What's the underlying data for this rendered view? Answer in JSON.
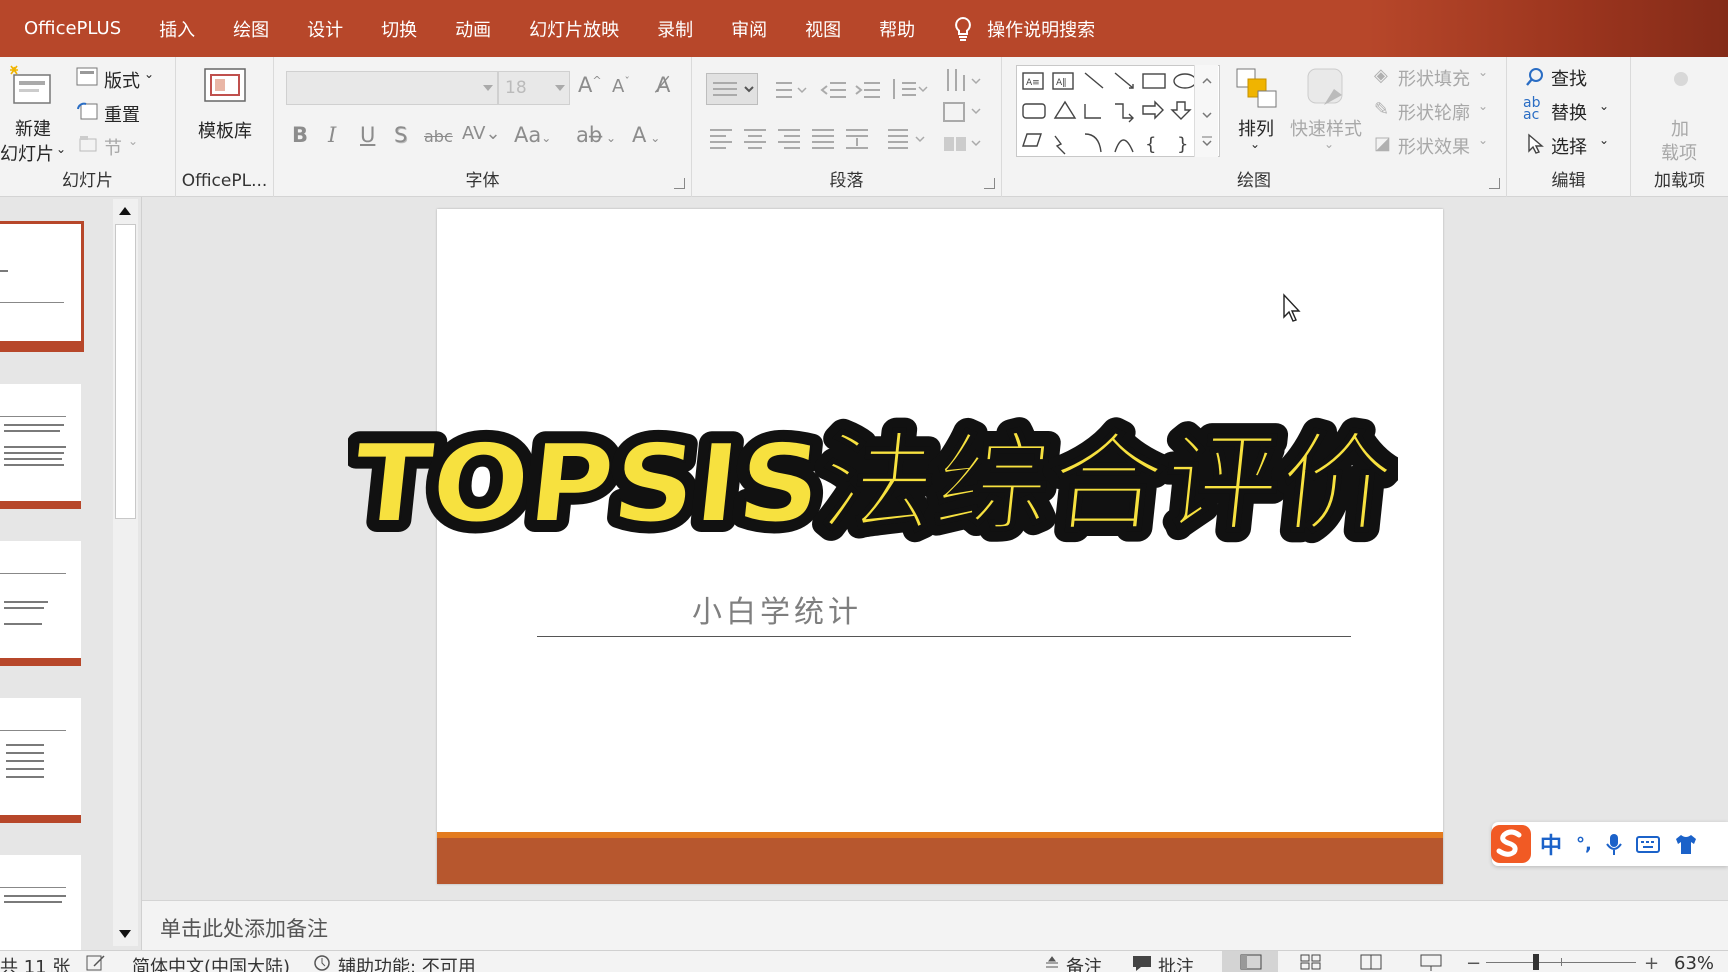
{
  "menubar": {
    "tabs": [
      "OfficePLUS",
      "插入",
      "绘图",
      "设计",
      "切换",
      "动画",
      "幻灯片放映",
      "录制",
      "审阅",
      "视图",
      "帮助"
    ],
    "tell_me": "操作说明搜索"
  },
  "ribbon": {
    "slides_group": {
      "label": "幻灯片",
      "new_slide": "新建",
      "new_slide_2": "幻灯片",
      "layout": "版式",
      "reset": "重置",
      "section": "节"
    },
    "officeplus_group": {
      "label": "OfficePL...",
      "template": "模板库"
    },
    "font_group": {
      "label": "字体",
      "font_size": "18",
      "change_case": "Aa",
      "bold": "B",
      "italic": "I",
      "underline": "U",
      "shadow": "S",
      "strike": "abc"
    },
    "paragraph_group": {
      "label": "段落"
    },
    "drawing_group": {
      "label": "绘图",
      "arrange": "排列",
      "quick_styles": "快速样式",
      "shape_fill": "形状填充",
      "shape_outline": "形状轮廓",
      "shape_effects": "形状效果"
    },
    "editing_group": {
      "label": "编辑",
      "find": "查找",
      "replace": "替换",
      "select": "选择"
    },
    "addins_group": {
      "label": "加载项",
      "addins_1": "加",
      "addins_2": "载项"
    }
  },
  "slide": {
    "title": "TOPSIS法综合评价",
    "subtitle": "小白学统计"
  },
  "notes": {
    "placeholder": "单击此处添加备注"
  },
  "status": {
    "slide_count": "共 11 张",
    "language": "简体中文(中国大陆)",
    "accessibility": "辅助功能: 不可用",
    "notes_btn": "备注",
    "comments_btn": "批注",
    "zoom": "63%"
  },
  "ime": {
    "mode": "中"
  },
  "colors": {
    "accent": "#b7472a",
    "title_fill": "#f7e13f",
    "slide_band": "#b7572e",
    "slide_line": "#e37b1f"
  }
}
